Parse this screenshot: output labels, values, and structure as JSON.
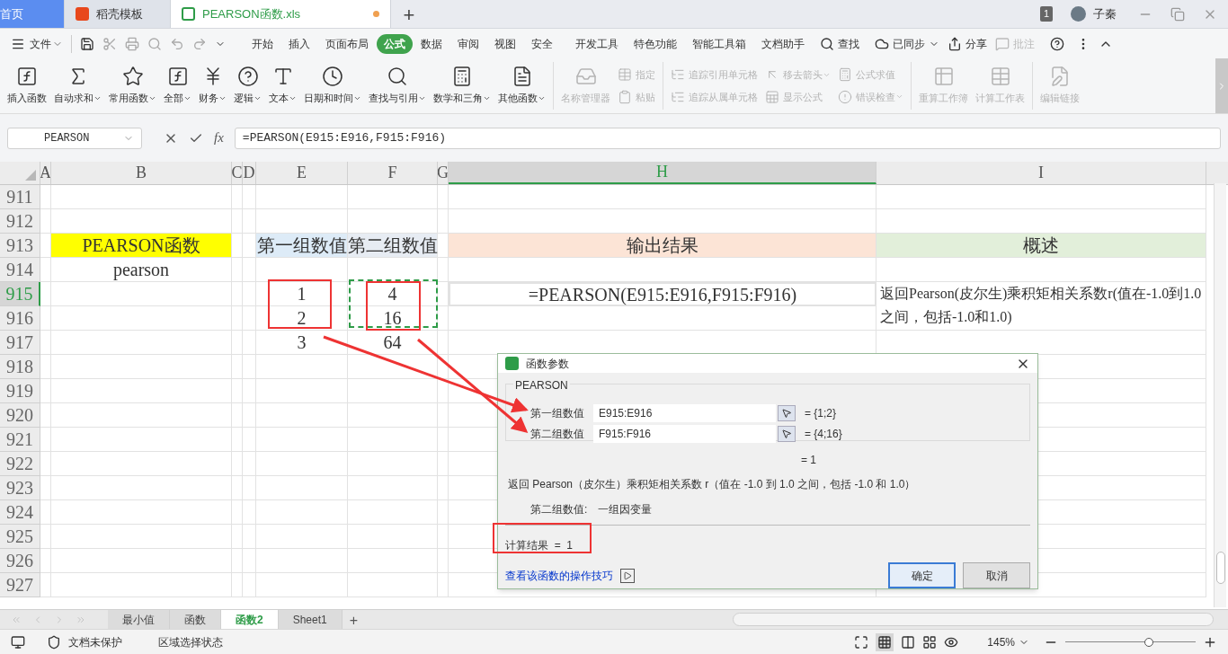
{
  "title_bar": {
    "tabs": [
      {
        "label": "首页",
        "kind": "home",
        "selected": false,
        "unsaved": false
      },
      {
        "label": "稻壳模板",
        "kind": "docer",
        "selected": false,
        "unsaved": false
      },
      {
        "label": "PEARSON函数.xls",
        "kind": "sheet",
        "selected": true,
        "unsaved": true
      }
    ],
    "new_tab": "+",
    "badge": "1",
    "user": "子秦"
  },
  "menu": {
    "file": "文件",
    "tabs": [
      {
        "label": "开始",
        "selected": false
      },
      {
        "label": "插入",
        "selected": false
      },
      {
        "label": "页面布局",
        "selected": false
      },
      {
        "label": "公式",
        "selected": true
      },
      {
        "label": "数据",
        "selected": false
      },
      {
        "label": "审阅",
        "selected": false
      },
      {
        "label": "视图",
        "selected": false
      },
      {
        "label": "安全",
        "selected": false
      },
      {
        "label": "开发工具",
        "selected": false
      },
      {
        "label": "特色功能",
        "selected": false
      },
      {
        "label": "智能工具箱",
        "selected": false
      },
      {
        "label": "文档助手",
        "selected": false
      }
    ],
    "search": "查找",
    "sync": "已同步",
    "share": "分享",
    "comment": {
      "label": "批注",
      "disabled": true
    }
  },
  "ribbon": {
    "items": [
      {
        "kind": "large",
        "label": "插入函数",
        "dropdown": false,
        "disabled": false
      },
      {
        "kind": "large",
        "label": "自动求和",
        "dropdown": true,
        "disabled": false
      },
      {
        "kind": "large",
        "label": "常用函数",
        "dropdown": true,
        "disabled": false
      },
      {
        "kind": "large",
        "label": "全部",
        "dropdown": true,
        "disabled": false
      },
      {
        "kind": "large",
        "label": "财务",
        "dropdown": true,
        "disabled": false
      },
      {
        "kind": "large",
        "label": "逻辑",
        "dropdown": true,
        "disabled": false
      },
      {
        "kind": "large",
        "label": "文本",
        "dropdown": true,
        "disabled": false
      },
      {
        "kind": "large",
        "label": "日期和时间",
        "dropdown": true,
        "disabled": false
      },
      {
        "kind": "large",
        "label": "查找与引用",
        "dropdown": true,
        "disabled": false
      },
      {
        "kind": "large",
        "label": "数学和三角",
        "dropdown": true,
        "disabled": false
      },
      {
        "kind": "large",
        "label": "其他函数",
        "dropdown": true,
        "disabled": false
      },
      {
        "kind": "separator"
      },
      {
        "kind": "large",
        "label": "名称管理器",
        "dropdown": false,
        "disabled": true
      },
      {
        "kind": "pair",
        "disabled": true,
        "items": [
          {
            "label": "指定",
            "dropdown": false
          },
          {
            "label": "粘贴",
            "dropdown": false
          }
        ]
      },
      {
        "kind": "separator"
      },
      {
        "kind": "pair",
        "disabled": true,
        "items": [
          {
            "label": "追踪引用单元格",
            "dropdown": false
          },
          {
            "label": "追踪从属单元格",
            "dropdown": false
          }
        ]
      },
      {
        "kind": "pair",
        "disabled": true,
        "items": [
          {
            "label": "移去箭头",
            "dropdown": true
          },
          {
            "label": "显示公式",
            "dropdown": false
          }
        ]
      },
      {
        "kind": "pair",
        "disabled": true,
        "items": [
          {
            "label": "公式求值",
            "dropdown": false
          },
          {
            "label": "错误检查",
            "dropdown": true
          }
        ]
      },
      {
        "kind": "separator"
      },
      {
        "kind": "large",
        "label": "重算工作簿",
        "dropdown": false,
        "disabled": true
      },
      {
        "kind": "large",
        "label": "计算工作表",
        "dropdown": false,
        "disabled": true
      },
      {
        "kind": "separator"
      },
      {
        "kind": "large",
        "label": "编辑链接",
        "dropdown": false,
        "disabled": true
      }
    ]
  },
  "formula_bar": {
    "name_box": "PEARSON",
    "function_label": "fx",
    "formula": "=PEARSON(E915:E916,F915:F916)"
  },
  "sheet": {
    "columns": [
      {
        "label": "A",
        "selected": false
      },
      {
        "label": "B",
        "selected": false
      },
      {
        "label": "C",
        "selected": false
      },
      {
        "label": "D",
        "selected": false
      },
      {
        "label": "E",
        "selected": false
      },
      {
        "label": "F",
        "selected": false
      },
      {
        "label": "G",
        "selected": false
      },
      {
        "label": "H",
        "selected": true
      },
      {
        "label": "I",
        "selected": false
      }
    ],
    "rows": [
      {
        "number": "911",
        "selected": false
      },
      {
        "number": "912",
        "selected": false
      },
      {
        "number": "913",
        "selected": false,
        "cells": {
          "b": {
            "text": "PEARSON函数",
            "color": "#ffff00",
            "selected": false
          },
          "e": {
            "text": "第一组数值",
            "color": "#ddebf7",
            "selected": false
          },
          "f": {
            "text": "第二组数值",
            "color": "#e7ecf3",
            "selected": false
          },
          "h": {
            "text": "输出结果",
            "color": "#fce4d6",
            "selected": false
          },
          "i": {
            "text": "概述",
            "color": "#e2efda",
            "selected": false
          }
        }
      },
      {
        "number": "914",
        "selected": false,
        "cells": {
          "b": {
            "text": "pearson",
            "selected": false
          }
        }
      },
      {
        "number": "915",
        "selected": true,
        "cells": {
          "e": {
            "text": "1",
            "selected": false
          },
          "f": {
            "text": "4",
            "selected": false
          },
          "h": {
            "text": "=PEARSON(E915:E916,F915:F916)",
            "selected": true
          },
          "i": {
            "text": "返回Pearson(皮尔生)乘积矩相关系数r(值在-1.0到1.0之间，包括-1.0和1.0)",
            "selected": false,
            "merged_down": true
          }
        }
      },
      {
        "number": "916",
        "selected": false,
        "cells": {
          "e": {
            "text": "2",
            "selected": false
          },
          "f": {
            "text": "16",
            "selected": false
          }
        }
      },
      {
        "number": "917",
        "selected": false,
        "cells": {
          "e": {
            "text": "3",
            "selected": false
          },
          "f": {
            "text": "64",
            "selected": false
          }
        }
      },
      {
        "number": "918",
        "selected": false
      },
      {
        "number": "919",
        "selected": false
      },
      {
        "number": "920",
        "selected": false
      },
      {
        "number": "921",
        "selected": false
      },
      {
        "number": "922",
        "selected": false
      },
      {
        "number": "923",
        "selected": false
      },
      {
        "number": "924",
        "selected": false
      },
      {
        "number": "925",
        "selected": false
      },
      {
        "number": "926",
        "selected": false
      },
      {
        "number": "927",
        "selected": false
      }
    ]
  },
  "sheet_tabs": {
    "tabs": [
      {
        "label": "最小值",
        "selected": false
      },
      {
        "label": "函数",
        "selected": false
      },
      {
        "label": "函数2",
        "selected": true
      },
      {
        "label": "Sheet1",
        "selected": false
      }
    ],
    "add": "+"
  },
  "status_bar": {
    "protection": "文档未保护",
    "mode": "区域选择状态",
    "zoom": "145%",
    "zoom_slider": {
      "level": 0.64
    }
  },
  "dialog": {
    "title": "函数参数",
    "function": "PEARSON",
    "arguments": [
      {
        "label": "第一组数值",
        "value": "E915:E916",
        "result": "= {1;2}"
      },
      {
        "label": "第二组数值",
        "value": "F915:F916",
        "result": "= {4;16}"
      }
    ],
    "result": "= 1",
    "description": "返回 Pearson（皮尔生）乘积矩相关系数 r（值在 -1.0 到 1.0 之间，包括 -1.0 和 1.0）",
    "argument_help": {
      "label": "第二组数值:",
      "text": "一组因变量"
    },
    "computed": "计算结果  =  1",
    "link": "查看该函数的操作技巧",
    "buttons": [
      {
        "label": "确定",
        "kind": "primary"
      },
      {
        "label": "取消",
        "kind": "normal"
      }
    ]
  }
}
